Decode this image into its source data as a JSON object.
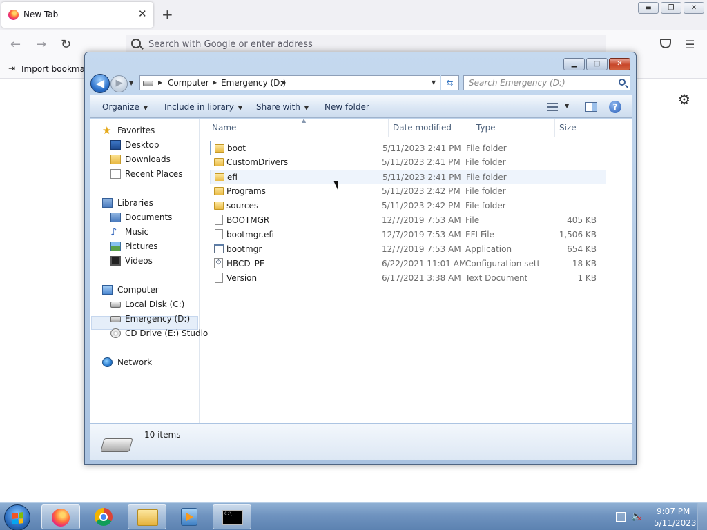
{
  "browser": {
    "tab_title": "New Tab",
    "tab_close": "✕",
    "new_tab": "+",
    "back": "←",
    "forward": "→",
    "reload": "↻",
    "search_placeholder": "Search with Google or enter address",
    "bookmark_label": "Import bookmarks...",
    "bookmark_icon": "⇥",
    "menu_icon": "☰",
    "gear_icon": "⚙",
    "win_minimize": "▬",
    "win_restore": "❐",
    "win_close": "✕"
  },
  "explorer": {
    "window_buttons": {
      "minimize": "▁",
      "maximize": "□",
      "close": "✕"
    },
    "nav": {
      "back": "◀",
      "forward": "▶",
      "dropdown": "▼"
    },
    "breadcrumb": [
      {
        "label": "Computer"
      },
      {
        "label": "Emergency (D:)"
      }
    ],
    "breadcrumb_sep": "▶",
    "refresh": "⇆",
    "search_placeholder": "Search Emergency (D:)",
    "toolbar": {
      "organize": "Organize",
      "include_in_library": "Include in library",
      "share_with": "Share with",
      "new_folder": "New folder",
      "dropdown": "▼"
    },
    "sidebar": {
      "favorites": {
        "header": "Favorites",
        "items": [
          {
            "label": "Desktop",
            "icon": "desktop-icon"
          },
          {
            "label": "Downloads",
            "icon": "folder-icon"
          },
          {
            "label": "Recent Places",
            "icon": "document-icon"
          }
        ]
      },
      "libraries": {
        "header": "Libraries",
        "items": [
          {
            "label": "Documents",
            "icon": "library-icon"
          },
          {
            "label": "Music",
            "icon": "music-icon"
          },
          {
            "label": "Pictures",
            "icon": "picture-icon"
          },
          {
            "label": "Videos",
            "icon": "video-icon"
          }
        ]
      },
      "computer": {
        "header": "Computer",
        "items": [
          {
            "label": "Local Disk (C:)",
            "icon": "disk-icon"
          },
          {
            "label": "Emergency (D:)",
            "icon": "disk-icon"
          },
          {
            "label": "CD Drive (E:) Studio",
            "icon": "cd-drive-icon"
          }
        ]
      },
      "network": {
        "header": "Network"
      }
    },
    "columns": {
      "name": "Name",
      "date_modified": "Date modified",
      "type": "Type",
      "size": "Size",
      "sort_indicator": "▲"
    },
    "files": [
      {
        "name": "boot",
        "date": "5/11/2023 2:41 PM",
        "type": "File folder",
        "size": "",
        "icon": "folder-icon"
      },
      {
        "name": "CustomDrivers",
        "date": "5/11/2023 2:41 PM",
        "type": "File folder",
        "size": "",
        "icon": "folder-icon"
      },
      {
        "name": "efi",
        "date": "5/11/2023 2:41 PM",
        "type": "File folder",
        "size": "",
        "icon": "folder-icon"
      },
      {
        "name": "Programs",
        "date": "5/11/2023 2:42 PM",
        "type": "File folder",
        "size": "",
        "icon": "folder-icon"
      },
      {
        "name": "sources",
        "date": "5/11/2023 2:42 PM",
        "type": "File folder",
        "size": "",
        "icon": "folder-icon"
      },
      {
        "name": "BOOTMGR",
        "date": "12/7/2019 7:53 AM",
        "type": "File",
        "size": "405 KB",
        "icon": "file-icon"
      },
      {
        "name": "bootmgr.efi",
        "date": "12/7/2019 7:53 AM",
        "type": "EFI File",
        "size": "1,506 KB",
        "icon": "file-icon"
      },
      {
        "name": "bootmgr",
        "date": "12/7/2019 7:53 AM",
        "type": "Application",
        "size": "654 KB",
        "icon": "application-icon"
      },
      {
        "name": "HBCD_PE",
        "date": "6/22/2021 11:01 AM",
        "type": "Configuration sett...",
        "size": "18 KB",
        "icon": "config-file-icon"
      },
      {
        "name": "Version",
        "date": "6/17/2021 3:38 AM",
        "type": "Text Document",
        "size": "1 KB",
        "icon": "text-file-icon"
      }
    ],
    "status": {
      "item_count": "10 items"
    }
  },
  "taskbar": {
    "cmd_label": "C:\\_",
    "clock_time": "9:07 PM",
    "clock_date": "5/11/2023",
    "speaker_icon": "🔈",
    "mute_mark": "✕"
  },
  "colors": {
    "win_frame": "#b4cbe6",
    "selection": "#e5eef9",
    "taskbar": "#6f93bf",
    "start_flag": [
      "#f35325",
      "#81bc06",
      "#05a6f0",
      "#ffba08"
    ]
  }
}
